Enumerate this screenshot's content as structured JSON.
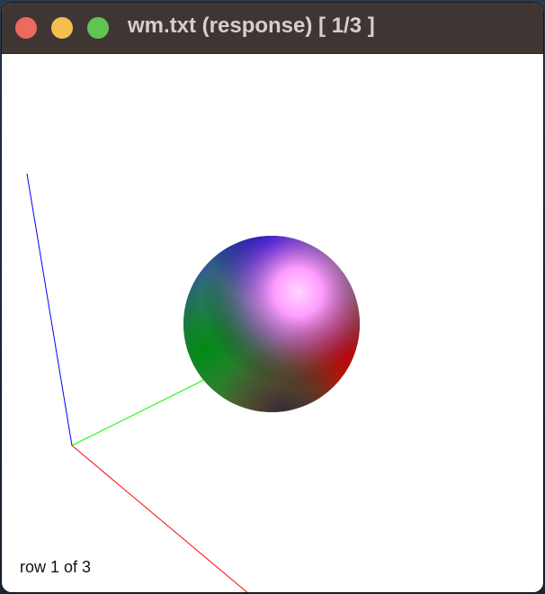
{
  "window": {
    "title": "wm.txt (response) [ 1/3 ]",
    "controls": {
      "close": "close-button",
      "minimize": "minimize-button",
      "zoom": "zoom-button"
    }
  },
  "viewport": {
    "status_text": "row 1 of 3",
    "axes": {
      "x_color": "#ff0000",
      "y_color": "#00ff00",
      "z_color": "#0000ff"
    },
    "sphere_colors": {
      "top": "#0000ff",
      "highlight": "#ffb3ff",
      "right": "#ff0000",
      "left": "#008000"
    }
  }
}
